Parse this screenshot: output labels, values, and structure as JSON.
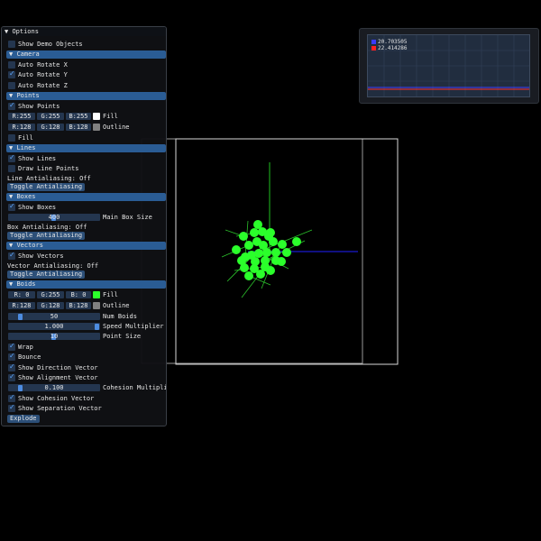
{
  "colors": {
    "accent": "#2a5c94",
    "boid": "#2bff2b",
    "fill_white": "#ffffff",
    "outline_gray": "#808080"
  },
  "options": {
    "title": "Options",
    "show_demo": {
      "label": "Show Demo Objects",
      "checked": false
    },
    "camera": {
      "header": "Camera",
      "auto_x": {
        "label": "Auto Rotate X",
        "checked": false
      },
      "auto_y": {
        "label": "Auto Rotate Y",
        "checked": true
      },
      "auto_z": {
        "label": "Auto Rotate Z",
        "checked": false
      }
    },
    "points": {
      "header": "Points",
      "show": {
        "label": "Show Points",
        "checked": true
      },
      "fill_rgb": [
        "R:255",
        "G:255",
        "B:255"
      ],
      "fill_label": "Fill",
      "outline_rgb": [
        "R:128",
        "G:128",
        "B:128"
      ],
      "outline_label": "Outline",
      "fill_toggle": {
        "label": "Fill",
        "checked": false
      }
    },
    "lines": {
      "header": "Lines",
      "show": {
        "label": "Show Lines",
        "checked": true
      },
      "draw_points": {
        "label": "Draw Line Points",
        "checked": false
      },
      "aa_status": "Line Antialiasing: Off",
      "toggle": "Toggle Antialiasing"
    },
    "boxes": {
      "header": "Boxes",
      "show": {
        "label": "Show Boxes",
        "checked": true
      },
      "main_box_size": {
        "value": "400",
        "label": "Main Box Size"
      },
      "aa_status": "Box Antialiasing: Off",
      "toggle": "Toggle Antialiasing"
    },
    "vectors": {
      "header": "Vectors",
      "show": {
        "label": "Show Vectors",
        "checked": true
      },
      "aa_status": "Vector Antialiasing: Off",
      "toggle": "Toggle Antialiasing"
    },
    "boids": {
      "header": "Boids",
      "fill_rgb": [
        "R:  0",
        "G:255",
        "B:  0"
      ],
      "fill_label": "Fill",
      "outline_rgb": [
        "R:128",
        "G:128",
        "B:128"
      ],
      "outline_label": "Outline",
      "num_boids": {
        "value": "50",
        "label": "Num Boids"
      },
      "speed": {
        "value": "1.000",
        "label": "Speed Multiplier"
      },
      "point_size": {
        "value": "10",
        "label": "Point Size"
      },
      "wrap": {
        "label": "Wrap",
        "checked": true
      },
      "bounce": {
        "label": "Bounce",
        "checked": true
      },
      "show_direction": {
        "label": "Show Direction Vector",
        "checked": true
      },
      "show_alignment": {
        "label": "Show Alignment Vector",
        "checked": true
      },
      "cohesion": {
        "value": "0.100",
        "label": "Cohesion Multiplier"
      },
      "show_cohesion": {
        "label": "Show Cohesion Vector",
        "checked": true
      },
      "show_separation": {
        "label": "Show Separation Vector",
        "checked": true
      },
      "explode": "Explode"
    }
  },
  "plot": {
    "legend": [
      {
        "value": "20.703505",
        "color": "#3a3aff"
      },
      {
        "value": "22.414286",
        "color": "#ff2020"
      }
    ]
  }
}
